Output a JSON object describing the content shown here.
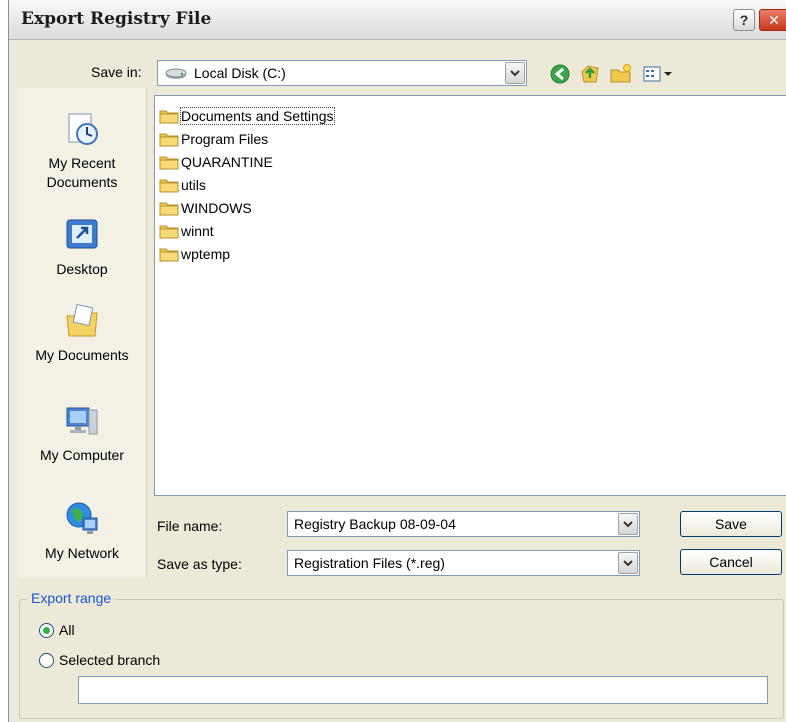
{
  "dialog": {
    "title": "Export Registry File",
    "help_button": "?",
    "close_button": "✕"
  },
  "save_in": {
    "label": "Save in:",
    "value": "Local Disk (C:)",
    "icons": [
      "drive-icon",
      "back-icon",
      "up-folder-icon",
      "new-folder-icon",
      "view-menu-icon"
    ]
  },
  "places": [
    {
      "label": "My Recent\nDocuments",
      "icon": "recent-documents-icon"
    },
    {
      "label": "Desktop",
      "icon": "desktop-icon"
    },
    {
      "label": "My Documents",
      "icon": "my-documents-icon"
    },
    {
      "label": "My Computer",
      "icon": "my-computer-icon"
    },
    {
      "label": "My Network",
      "icon": "my-network-icon"
    }
  ],
  "files": [
    {
      "name": "Documents and Settings"
    },
    {
      "name": "Program Files"
    },
    {
      "name": "QUARANTINE"
    },
    {
      "name": "utils"
    },
    {
      "name": "WINDOWS"
    },
    {
      "name": "winnt"
    },
    {
      "name": "wptemp"
    }
  ],
  "file_name": {
    "label": "File name:",
    "value": "Registry Backup 08-09-04"
  },
  "save_as_type": {
    "label": "Save as type:",
    "value": "Registration Files (*.reg)"
  },
  "buttons": {
    "save": "Save",
    "cancel": "Cancel"
  },
  "export_range": {
    "title": "Export range",
    "all_label": "All",
    "selected_branch_label": "Selected branch",
    "selected_option": "All",
    "branch_value": ""
  },
  "colors": {
    "folder": "#f0c94a",
    "group_title": "#1a55d6",
    "radio_selected": "#2bb240"
  }
}
